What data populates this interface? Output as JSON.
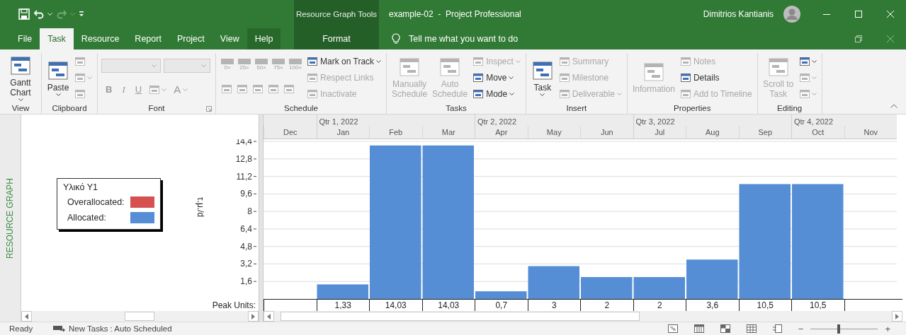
{
  "title_bar": {
    "quick_access": [
      {
        "kind": "save",
        "disabled": false,
        "dropdown": false
      },
      {
        "kind": "undo",
        "disabled": false,
        "dropdown": true
      },
      {
        "kind": "redo",
        "disabled": true,
        "dropdown": true
      },
      {
        "kind": "customize",
        "disabled": false,
        "dropdown": false
      }
    ],
    "contextual_label": "Resource Graph Tools",
    "title": "example-02  -  Project Professional",
    "user": "Dimitrios Kantianis"
  },
  "tabs": [
    {
      "label": "File",
      "kind": "normal",
      "selected": false,
      "hovered": false
    },
    {
      "label": "Task",
      "kind": "normal",
      "selected": true,
      "hovered": false
    },
    {
      "label": "Resource",
      "kind": "normal",
      "selected": false,
      "hovered": false
    },
    {
      "label": "Report",
      "kind": "normal",
      "selected": false,
      "hovered": false
    },
    {
      "label": "Project",
      "kind": "normal",
      "selected": false,
      "hovered": false
    },
    {
      "label": "View",
      "kind": "normal",
      "selected": false,
      "hovered": false
    },
    {
      "label": "Help",
      "kind": "normal",
      "selected": false,
      "hovered": true
    },
    {
      "label": "Format",
      "kind": "contextual",
      "selected": false,
      "hovered": false
    }
  ],
  "tell_me": {
    "placeholder": "Tell me what you want to do"
  },
  "ribbon": {
    "groups": [
      {
        "label": "View",
        "launcher": false,
        "columns": [
          [
            [
              {
                "kind": "large",
                "label": "Gantt Chart",
                "dropdown": true,
                "disabled": false
              }
            ]
          ]
        ]
      },
      {
        "label": "Clipboard",
        "launcher": false,
        "columns": [
          [
            [
              {
                "kind": "large",
                "label": "Paste",
                "dropdown": true,
                "disabled": false
              }
            ]
          ],
          [
            [
              {
                "kind": "icon",
                "dropdown": false,
                "disabled": true
              }
            ],
            [
              {
                "kind": "icon",
                "dropdown": true,
                "disabled": true
              }
            ],
            [
              {
                "kind": "icon",
                "dropdown": false,
                "disabled": true
              }
            ]
          ]
        ]
      },
      {
        "label": "Font",
        "launcher": true,
        "columns": [
          [
            [
              {
                "kind": "combo",
                "disabled": true
              },
              {
                "kind": "combo",
                "disabled": true
              }
            ],
            [
              {
                "kind": "bold",
                "label": "B",
                "dropdown": false,
                "disabled": true
              },
              {
                "kind": "italic",
                "label": "I",
                "dropdown": false,
                "disabled": true
              },
              {
                "kind": "underline",
                "label": "U",
                "dropdown": false,
                "disabled": true
              },
              {
                "kind": "icon",
                "dropdown": true,
                "disabled": true
              },
              {
                "kind": "glyph",
                "label": "A",
                "dropdown": true,
                "disabled": true
              }
            ]
          ]
        ]
      },
      {
        "label": "Schedule",
        "launcher": false,
        "columns": [
          [
            [
              {
                "kind": "percent",
                "label": "0×",
                "disabled": true
              },
              {
                "kind": "percent",
                "label": "25×",
                "disabled": true
              },
              {
                "kind": "percent",
                "label": "50×",
                "disabled": true
              },
              {
                "kind": "percent",
                "label": "75×",
                "disabled": true
              },
              {
                "kind": "percent",
                "label": "100×",
                "disabled": true
              }
            ],
            [
              {
                "kind": "icon",
                "dropdown": false,
                "disabled": true
              },
              {
                "kind": "icon",
                "dropdown": false,
                "disabled": true
              },
              {
                "kind": "icon",
                "dropdown": false,
                "disabled": true
              },
              {
                "kind": "icon",
                "dropdown": false,
                "disabled": true
              },
              {
                "kind": "icon",
                "dropdown": false,
                "disabled": true
              }
            ]
          ],
          [
            [
              {
                "kind": "small",
                "label": "Mark on Track",
                "dropdown": true,
                "disabled": false
              }
            ],
            [
              {
                "kind": "small",
                "label": "Respect Links",
                "dropdown": false,
                "disabled": true
              }
            ],
            [
              {
                "kind": "small",
                "label": "Inactivate",
                "dropdown": false,
                "disabled": true
              }
            ]
          ]
        ]
      },
      {
        "label": "Tasks",
        "launcher": false,
        "columns": [
          [
            [
              {
                "kind": "large",
                "label": "Manually Schedule",
                "dropdown": false,
                "disabled": true
              }
            ]
          ],
          [
            [
              {
                "kind": "large",
                "label": "Auto Schedule",
                "dropdown": false,
                "disabled": true
              }
            ]
          ],
          [
            [
              {
                "kind": "small",
                "label": "Inspect",
                "dropdown": true,
                "disabled": true
              }
            ],
            [
              {
                "kind": "small",
                "label": "Move",
                "dropdown": true,
                "disabled": false
              }
            ],
            [
              {
                "kind": "small",
                "label": "Mode",
                "dropdown": true,
                "disabled": false
              }
            ]
          ]
        ]
      },
      {
        "label": "Insert",
        "launcher": false,
        "columns": [
          [
            [
              {
                "kind": "large",
                "label": "Task",
                "dropdown": true,
                "disabled": false
              }
            ]
          ],
          [
            [
              {
                "kind": "small",
                "label": "Summary",
                "dropdown": false,
                "disabled": true
              }
            ],
            [
              {
                "kind": "small",
                "label": "Milestone",
                "dropdown": false,
                "disabled": true
              }
            ],
            [
              {
                "kind": "small",
                "label": "Deliverable",
                "dropdown": true,
                "disabled": true
              }
            ]
          ]
        ]
      },
      {
        "label": "Properties",
        "launcher": false,
        "columns": [
          [
            [
              {
                "kind": "large",
                "label": "Information",
                "dropdown": false,
                "disabled": true
              }
            ]
          ],
          [
            [
              {
                "kind": "small",
                "label": "Notes",
                "dropdown": false,
                "disabled": true
              }
            ],
            [
              {
                "kind": "small",
                "label": "Details",
                "dropdown": false,
                "disabled": false
              }
            ],
            [
              {
                "kind": "small",
                "label": "Add to Timeline",
                "dropdown": false,
                "disabled": true
              }
            ]
          ]
        ]
      },
      {
        "label": "Editing",
        "launcher": false,
        "columns": [
          [
            [
              {
                "kind": "large",
                "label": "Scroll to Task",
                "dropdown": false,
                "disabled": true
              }
            ]
          ],
          [
            [
              {
                "kind": "icon",
                "dropdown": true,
                "disabled": false
              }
            ],
            [
              {
                "kind": "icon",
                "dropdown": true,
                "disabled": true
              }
            ],
            [
              {
                "kind": "icon",
                "dropdown": true,
                "disabled": true
              }
            ]
          ]
        ]
      }
    ]
  },
  "main": {
    "side_label": "RESOURCE GRAPH",
    "legend": {
      "title": "Υλικό Υ1",
      "items": [
        {
          "label": "Overallocated:",
          "color": "#d75050"
        },
        {
          "label": "Allocated:",
          "color": "#558ed5"
        }
      ]
    },
    "timescale": {
      "columns": [
        {
          "month": "Dec"
        },
        {
          "month": "Jan",
          "quarter": "Qtr 1, 2022"
        },
        {
          "month": "Feb"
        },
        {
          "month": "Mar"
        },
        {
          "month": "Apr",
          "quarter": "Qtr 2, 2022"
        },
        {
          "month": "May"
        },
        {
          "month": "Jun"
        },
        {
          "month": "Jul",
          "quarter": "Qtr 3, 2022"
        },
        {
          "month": "Aug"
        },
        {
          "month": "Sep"
        },
        {
          "month": "Oct",
          "quarter": "Qtr 4, 2022"
        },
        {
          "month": "Nov"
        }
      ]
    },
    "chart_data": {
      "type": "bar",
      "ylabel": "τ.μ./d",
      "grid": true,
      "series": [
        {
          "color": "#558ed5",
          "values": [
            null,
            1.33,
            14.03,
            14.03,
            0.7,
            3,
            2,
            2,
            3.6,
            10.5,
            10.5,
            null
          ]
        }
      ],
      "ylim": [
        0,
        14.6
      ],
      "yticks": [
        {
          "value": 1.6,
          "label": "1,6"
        },
        {
          "value": 3.2,
          "label": "3,2"
        },
        {
          "value": 4.8,
          "label": "4,8"
        },
        {
          "value": 6.4,
          "label": "6,4"
        },
        {
          "value": 8,
          "label": "8"
        },
        {
          "value": 9.6,
          "label": "9,6"
        },
        {
          "value": 11.2,
          "label": "11,2"
        },
        {
          "value": 12.8,
          "label": "12,8"
        },
        {
          "value": 14.4,
          "label": "14,4"
        }
      ],
      "value_labels": [
        null,
        "1,33",
        "14,03",
        "14,03",
        "0,7",
        "3",
        "2",
        "2",
        "3,6",
        "10,5",
        "10,5",
        null
      ]
    },
    "peak_units": {
      "label": "Peak Units:"
    }
  },
  "status_bar": {
    "ready": "Ready",
    "new_tasks": "New Tasks : Auto Scheduled",
    "zoom": {
      "minus": "−",
      "plus": "+",
      "level": 0.42
    }
  }
}
